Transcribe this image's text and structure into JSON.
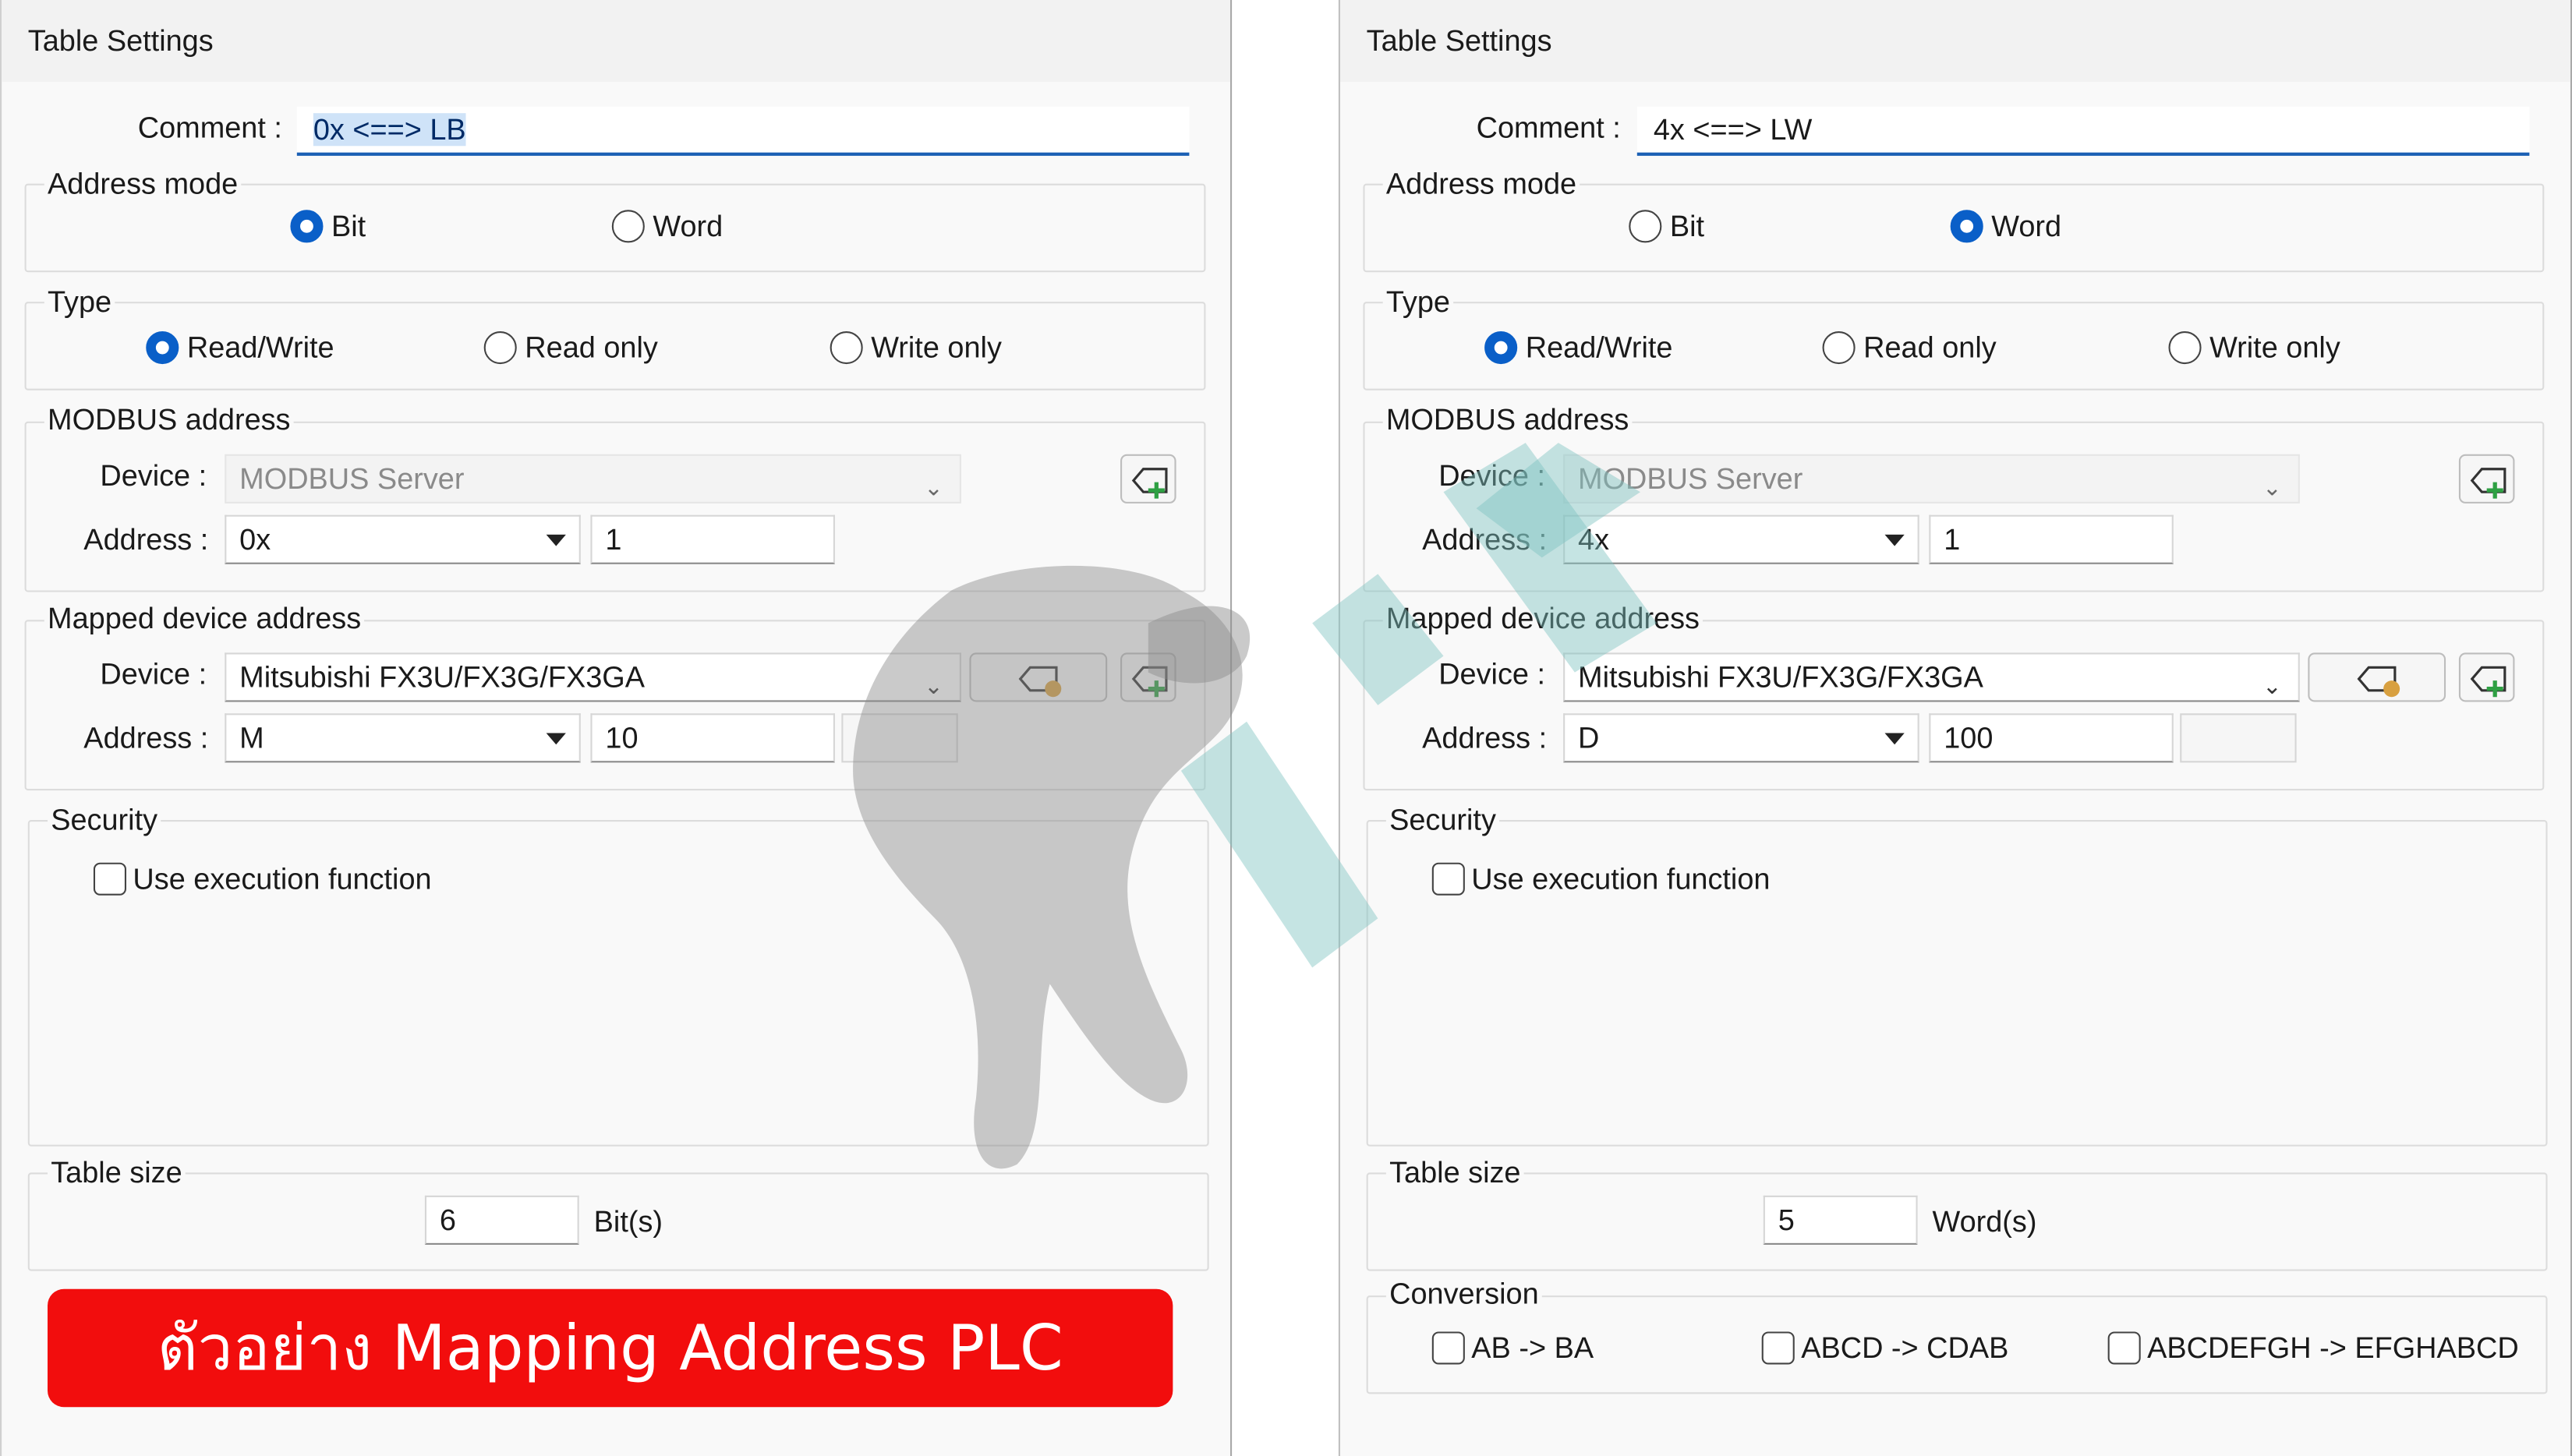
{
  "panels": [
    {
      "title": "Table Settings",
      "comment_label": "Comment :",
      "comment_value": "0x <==> LB",
      "address_mode": {
        "label": "Address mode",
        "bit": "Bit",
        "word": "Word",
        "selected": "Bit"
      },
      "type": {
        "label": "Type",
        "rw": "Read/Write",
        "ro": "Read only",
        "wo": "Write only",
        "selected": "Read/Write"
      },
      "modbus": {
        "label": "MODBUS address",
        "device_label": "Device :",
        "device_value": "MODBUS Server",
        "address_label": "Address :",
        "address_type": "0x",
        "address_value": "1"
      },
      "mapped": {
        "label": "Mapped device address",
        "device_label": "Device :",
        "device_value": "Mitsubishi FX3U/FX3G/FX3GA",
        "address_label": "Address :",
        "address_type": "M",
        "address_value": "10"
      },
      "security": {
        "label": "Security",
        "checkbox": "Use execution function"
      },
      "table_size": {
        "label": "Table size",
        "value": "6",
        "unit": "Bit(s)"
      },
      "banner": "ตัวอย่าง Mapping Address PLC"
    },
    {
      "title": "Table Settings",
      "comment_label": "Comment :",
      "comment_value": "4x <==> LW",
      "address_mode": {
        "label": "Address mode",
        "bit": "Bit",
        "word": "Word",
        "selected": "Word"
      },
      "type": {
        "label": "Type",
        "rw": "Read/Write",
        "ro": "Read only",
        "wo": "Write only",
        "selected": "Read/Write"
      },
      "modbus": {
        "label": "MODBUS address",
        "device_label": "Device :",
        "device_value": "MODBUS Server",
        "address_label": "Address :",
        "address_type": "4x",
        "address_value": "1"
      },
      "mapped": {
        "label": "Mapped device address",
        "device_label": "Device :",
        "device_value": "Mitsubishi FX3U/FX3G/FX3GA",
        "address_label": "Address :",
        "address_type": "D",
        "address_value": "100"
      },
      "security": {
        "label": "Security",
        "checkbox": "Use execution function"
      },
      "table_size": {
        "label": "Table size",
        "value": "5",
        "unit": "Word(s)"
      },
      "conversion": {
        "label": "Conversion",
        "opt1": "AB -> BA",
        "opt2": "ABCD -> CDAB",
        "opt3": "ABCDEFGH -> EFGHABCD"
      }
    }
  ],
  "colors": {
    "accent": "#0a5fc8",
    "banner": "#f20d0d",
    "comment_underline": "#1a5fb4"
  },
  "icons": [
    "add-device-icon",
    "device-settings-icon",
    "chevron-down-icon",
    "caret-down-icon"
  ]
}
